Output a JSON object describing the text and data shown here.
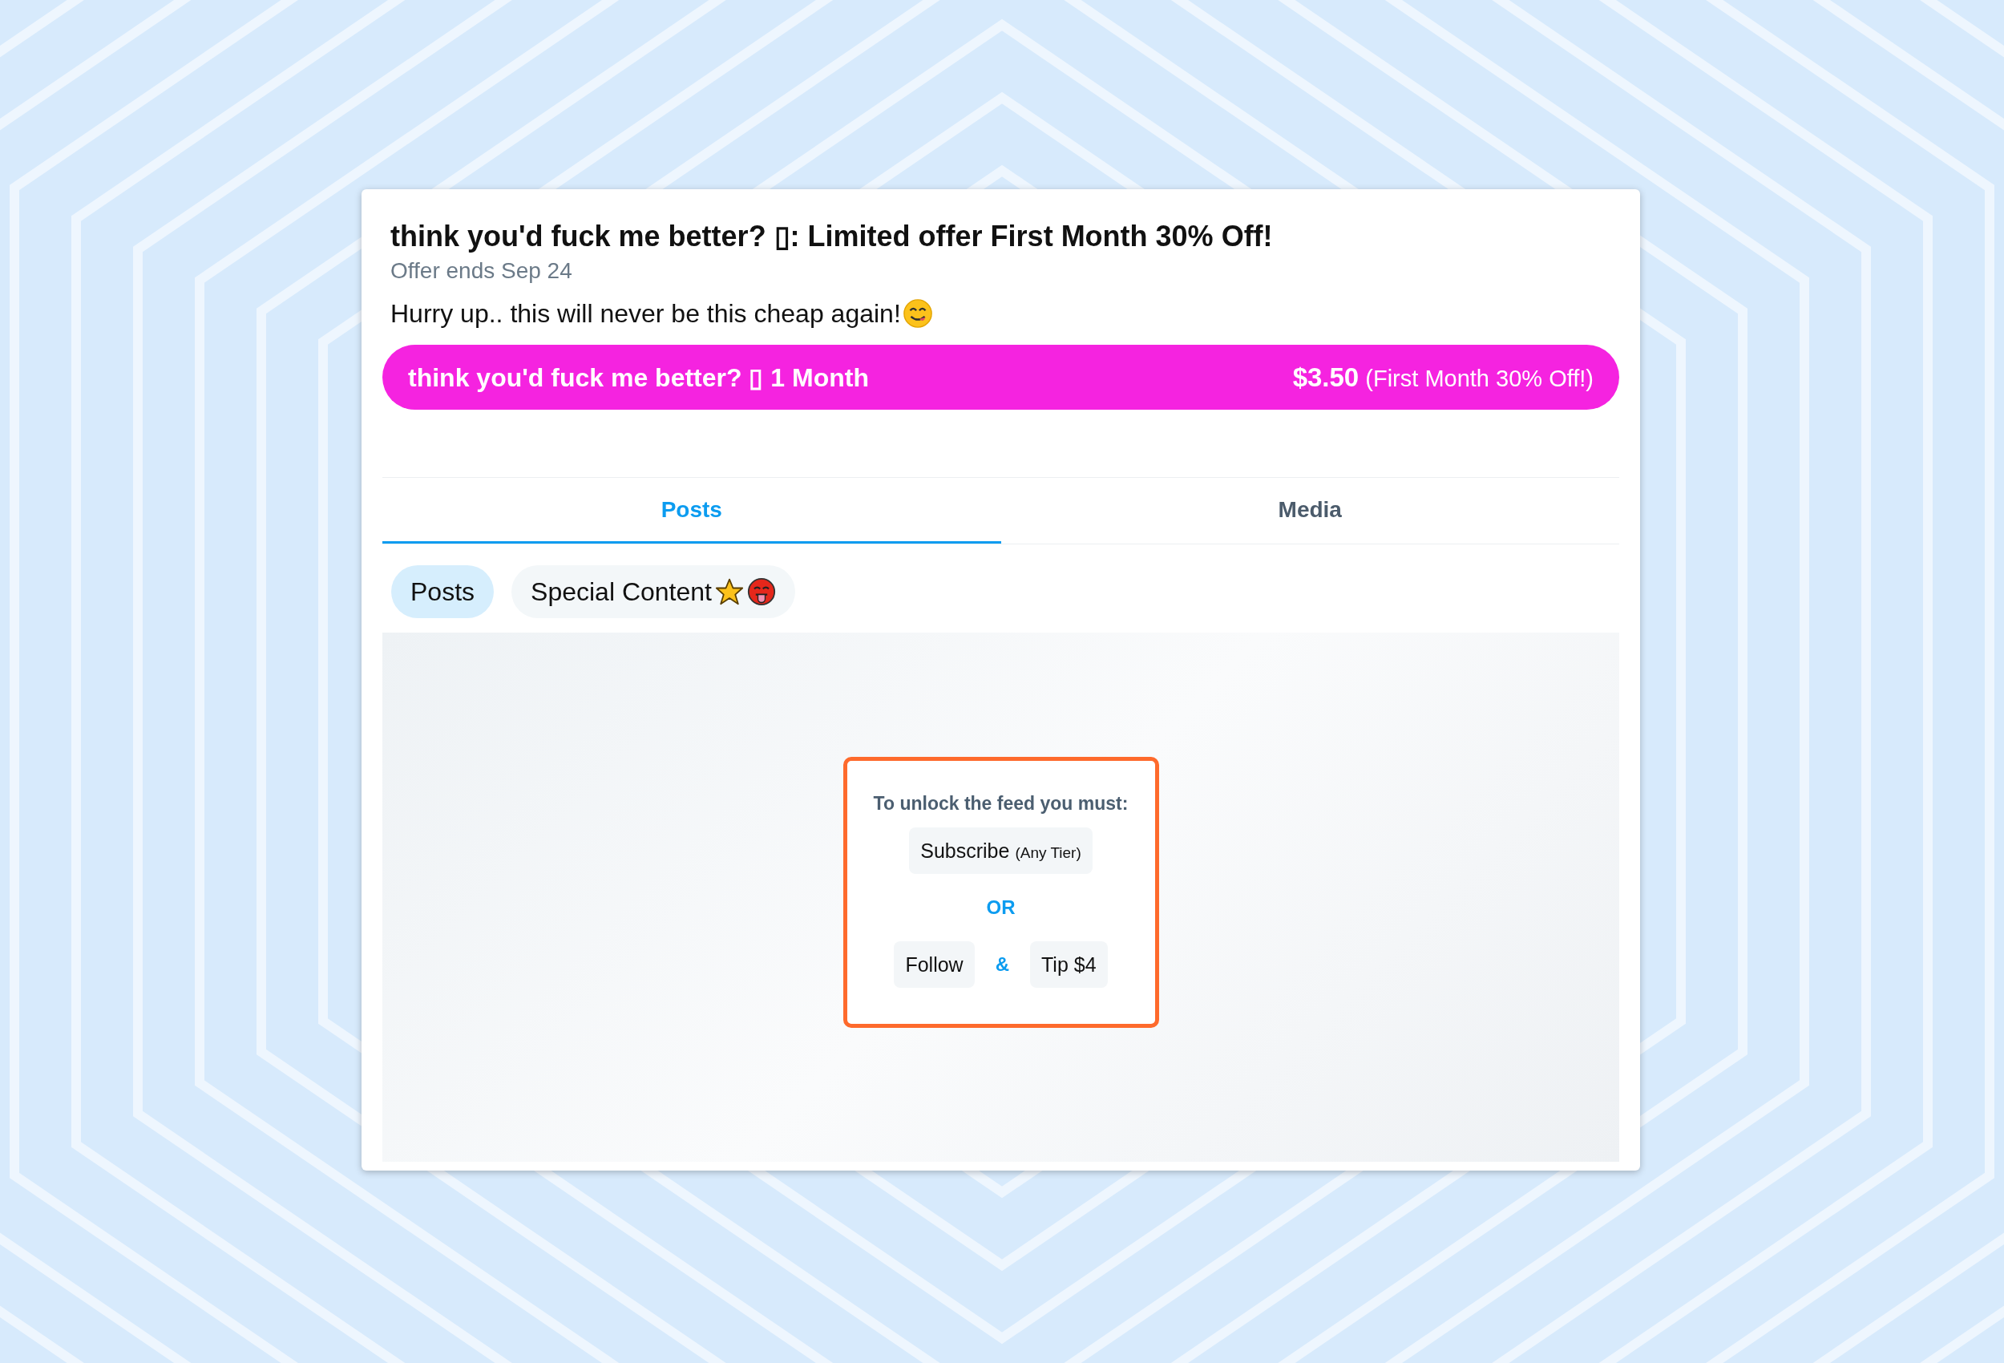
{
  "offer": {
    "title": "think you'd fuck me better? ▯: Limited offer First Month 30% Off!",
    "expiry": "Offer ends Sep 24",
    "message": "Hurry up.. this will never be this cheap again!"
  },
  "subscribe_button": {
    "label": "think you'd fuck me better? ▯ 1 Month",
    "price": "$3.50",
    "discount": "(First Month 30% Off!)"
  },
  "tabs": [
    {
      "label": "Posts",
      "selected": true
    },
    {
      "label": "Media",
      "selected": false
    }
  ],
  "filters": [
    {
      "label": "Posts",
      "selected": true
    },
    {
      "label": "Special Content",
      "selected": false
    }
  ],
  "lock": {
    "heading": "To unlock the feed you must:",
    "subscribe": {
      "label": "Subscribe",
      "note": "(Any Tier)"
    },
    "or": "OR",
    "follow": "Follow",
    "and": "&",
    "tip": "Tip $4"
  }
}
